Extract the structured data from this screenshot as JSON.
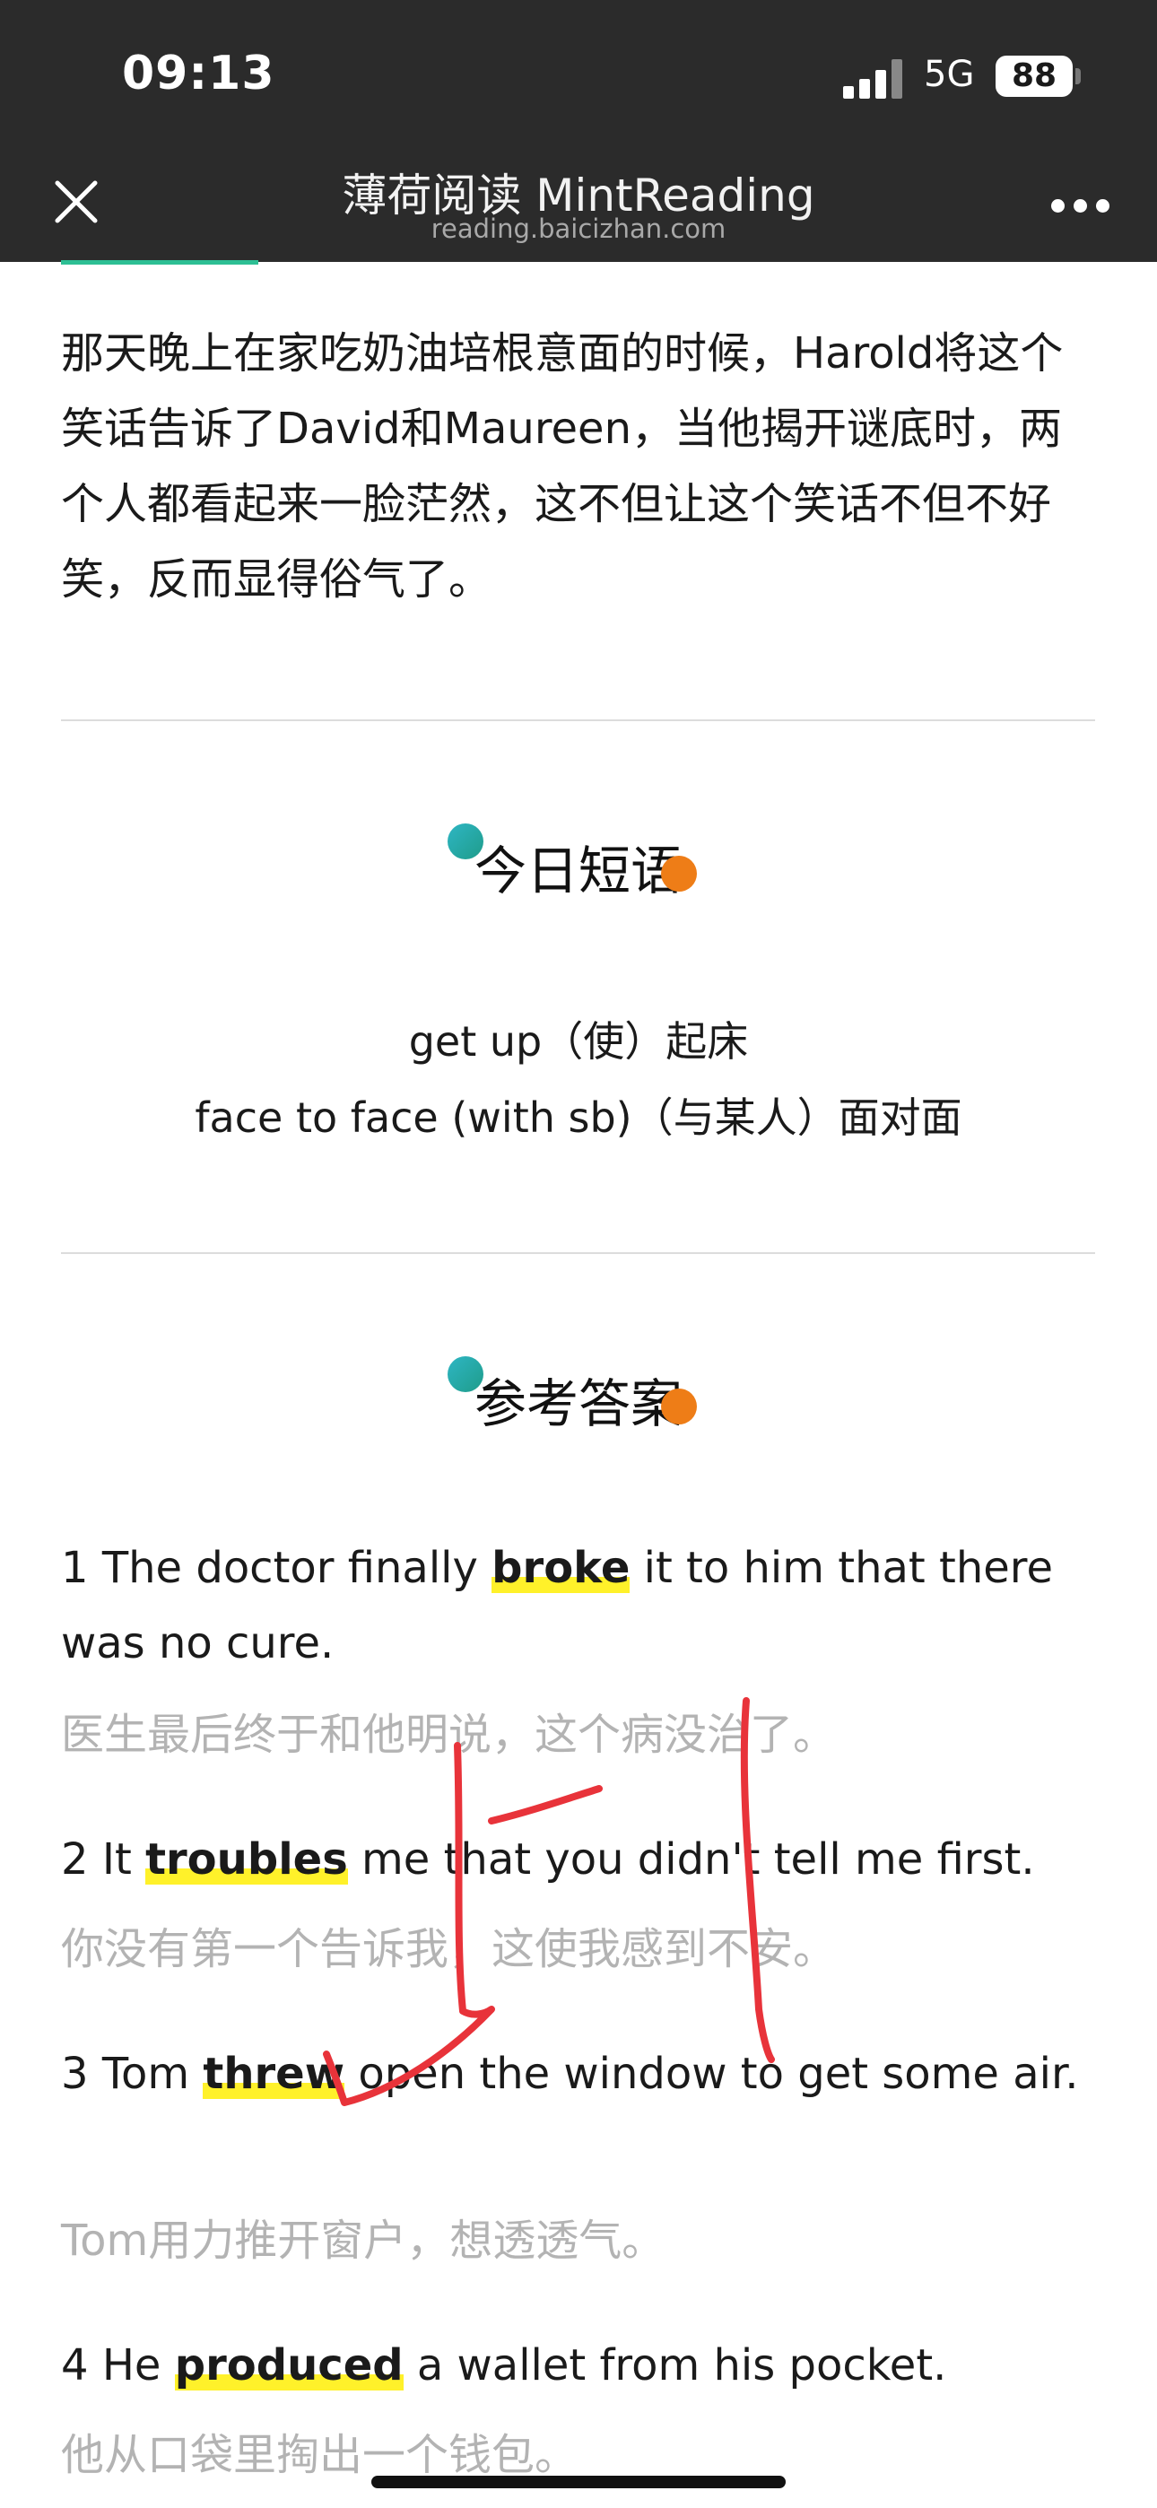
{
  "status_bar": {
    "time": "09:13",
    "network": "5G",
    "battery": "88"
  },
  "nav_bar": {
    "title": "薄荷阅读 MintReading",
    "subtitle": "reading.baicizhan.com",
    "close_icon": "close-icon",
    "more_icon": "more-icon"
  },
  "story": {
    "paragraph": "那天晚上在家吃奶油培根意面的时候，Harold将这个笑话告诉了David和Maureen，当他揭开谜底时，两个人都看起来一脸茫然，这不但让这个笑话不但不好笑，反而显得俗气了。"
  },
  "phrases_section": {
    "heading": "今日短语",
    "items": [
      "get up（使）起床",
      "face to face (with sb)（与某人）面对面"
    ]
  },
  "answers_section": {
    "heading": "参考答案",
    "items": [
      {
        "num": "1",
        "before": "The doctor finally",
        "keyword": "broke",
        "after": "it to him that there was no cure.",
        "translation": "医生最后终于和他明说，这个病没治了。"
      },
      {
        "num": "2",
        "before": "It",
        "keyword": "troubles",
        "after": "me that you didn't tell me first.",
        "translation": "你没有第一个告诉我，这使我感到不安。"
      },
      {
        "num": "3",
        "before": "Tom",
        "keyword": "threw",
        "after": "open the window to get some air.",
        "translation": "Tom用力推开窗户，想透透气。"
      },
      {
        "num": "4",
        "before": "He",
        "keyword": "produced",
        "after": "a wallet from his pocket.",
        "translation": "他从口袋里掏出一个钱包。"
      }
    ]
  },
  "colors": {
    "keyword_highlight": "#fff12a",
    "annotation_ink": "#e8333a",
    "dot_teal": "#2eb6c4",
    "dot_orange": "#ee7d17"
  }
}
